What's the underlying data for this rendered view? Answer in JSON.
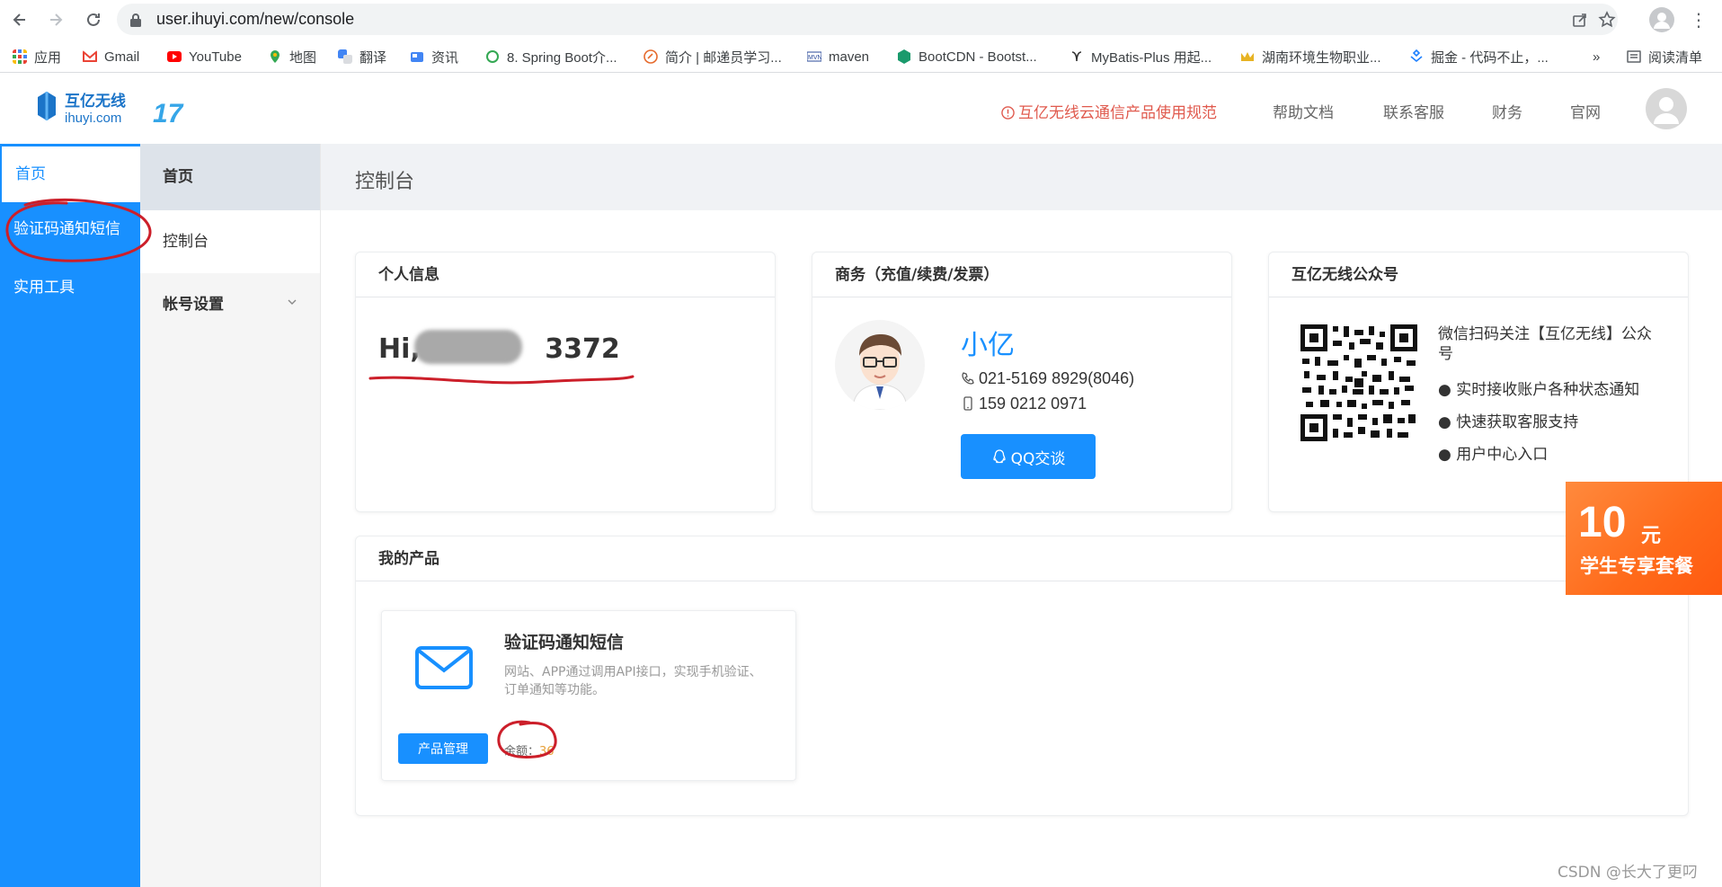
{
  "browser": {
    "url": "user.ihuyi.com/new/console",
    "bookmarks": [
      {
        "label": "应用",
        "icon": "apps-grid-icon"
      },
      {
        "label": "Gmail",
        "icon": "gmail-icon"
      },
      {
        "label": "YouTube",
        "icon": "youtube-icon"
      },
      {
        "label": "地图",
        "icon": "maps-icon"
      },
      {
        "label": "翻译",
        "icon": "translate-icon"
      },
      {
        "label": "资讯",
        "icon": "news-icon"
      },
      {
        "label": "8. Spring Boot介...",
        "icon": "spring-icon"
      },
      {
        "label": "简介 | 邮递员学习...",
        "icon": "postman-icon"
      },
      {
        "label": "maven",
        "icon": "maven-icon"
      },
      {
        "label": "BootCDN - Bootst...",
        "icon": "bootcdn-icon"
      },
      {
        "label": "MyBatis-Plus 用起...",
        "icon": "mybatis-icon"
      },
      {
        "label": "湖南环境生物职业...",
        "icon": "school-icon"
      },
      {
        "label": "掘金 - 代码不止，...",
        "icon": "juejin-icon"
      }
    ],
    "reading_list": "阅读清单",
    "more": "»"
  },
  "header": {
    "logo_text": "互亿无线",
    "logo_sub": "ihuyi.com",
    "logo_badge": "17",
    "warning_link": "互亿无线云通信产品使用规范",
    "links": [
      "帮助文档",
      "联系客服",
      "财务",
      "官网"
    ]
  },
  "sidebar": {
    "items": [
      {
        "label": "首页",
        "active": true
      },
      {
        "label": "验证码通知短信",
        "active": false
      },
      {
        "label": "实用工具",
        "active": false
      }
    ]
  },
  "subnav": {
    "head": "首页",
    "items": [
      {
        "label": "控制台"
      },
      {
        "label": "帐号设置"
      }
    ]
  },
  "page": {
    "title": "控制台"
  },
  "personal": {
    "heading": "个人信息",
    "greeting": "Hi, ",
    "phone_tail": "3372"
  },
  "business": {
    "heading": "商务（充值/续费/发票）",
    "name": "小亿",
    "phone": "021-5169 8929(8046)",
    "mobile": "159 0212 0971",
    "qq_button": "QQ交谈"
  },
  "wechat": {
    "heading": "互亿无线公众号",
    "lines": [
      "微信扫码关注【互亿无线】公众",
      "号"
    ],
    "bullets": [
      "● 实时接收账户各种状态通知",
      "● 快速获取客服支持",
      "● 用户中心入口"
    ]
  },
  "promo": {
    "amount": "10",
    "unit": "元",
    "subtitle": "学生专享套餐"
  },
  "products": {
    "heading": "我的产品",
    "card": {
      "title": "验证码通知短信",
      "description": "网站、APP通过调用API接口，实现手机验证、订单通知等功能。",
      "button": "产品管理",
      "balance_label": "余额：",
      "balance_value": "36"
    }
  },
  "watermark": "CSDN @长大了更叼",
  "colors": {
    "primary": "#1890ff",
    "warning": "#e05a4e",
    "promo": "#ff6a1a",
    "annotation": "#cc1f2a"
  }
}
